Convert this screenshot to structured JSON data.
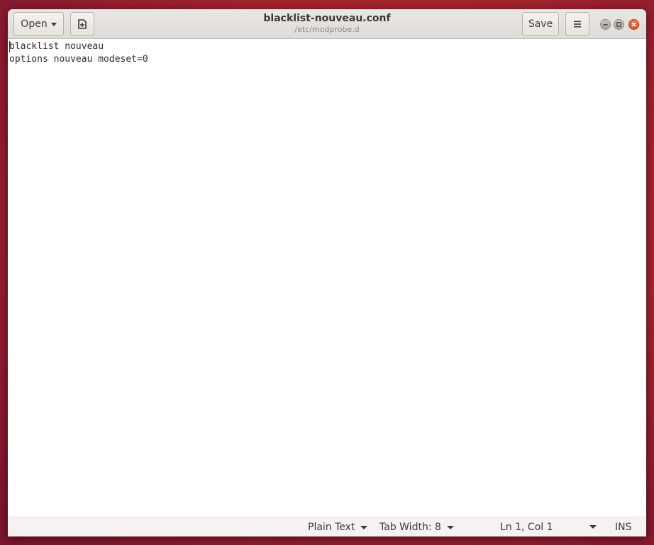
{
  "window": {
    "title": "blacklist-nouveau.conf",
    "subtitle": "/etc/modprobe.d"
  },
  "headerbar": {
    "open_label": "Open",
    "save_label": "Save"
  },
  "editor": {
    "lines": [
      "blacklist nouveau",
      "options nouveau modeset=0"
    ]
  },
  "statusbar": {
    "language": "Plain Text",
    "tab_width": "Tab Width: 8",
    "position": "Ln 1, Col 1",
    "mode": "INS"
  },
  "icons": {
    "new_document": "new-document-icon",
    "menu": "hamburger-menu-icon",
    "minimize": "minimize-icon",
    "maximize": "maximize-icon",
    "close": "close-icon"
  },
  "colors": {
    "close_button": "#e0502a",
    "headerbar": "#e3e0dc"
  }
}
